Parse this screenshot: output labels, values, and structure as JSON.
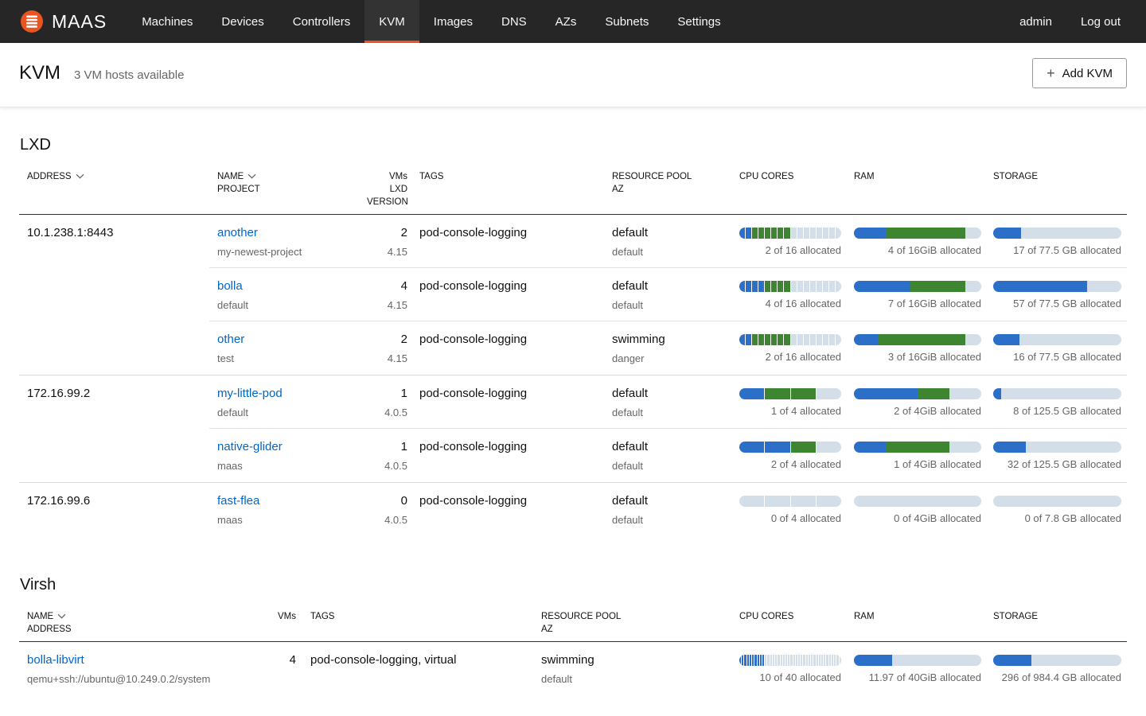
{
  "colors": {
    "nav_bg": "#262626",
    "nav_active_bg": "#333333",
    "accent_orange": "#E95420",
    "link_blue": "#0066CC",
    "meter_used": "#2C6FC8",
    "meter_other": "#3E8532",
    "meter_free": "#D3DEE8"
  },
  "nav": {
    "logo_text": "MAAS",
    "items": [
      {
        "label": "Machines",
        "active": false
      },
      {
        "label": "Devices",
        "active": false
      },
      {
        "label": "Controllers",
        "active": false
      },
      {
        "label": "KVM",
        "active": true
      },
      {
        "label": "Images",
        "active": false
      },
      {
        "label": "DNS",
        "active": false
      },
      {
        "label": "AZs",
        "active": false
      },
      {
        "label": "Subnets",
        "active": false
      },
      {
        "label": "Settings",
        "active": false
      }
    ],
    "right_items": [
      {
        "label": "admin"
      },
      {
        "label": "Log out"
      }
    ]
  },
  "header": {
    "title": "KVM",
    "subtitle": "3 VM hosts available",
    "add_button_label": "Add KVM",
    "add_button_icon": "+"
  },
  "lxd": {
    "title": "LXD",
    "headers": [
      {
        "line1": "ADDRESS",
        "sort": true
      },
      {
        "line1": "NAME",
        "line2": "PROJECT",
        "sort": true
      },
      {
        "line1": "VMs",
        "line2": "LXD VERSION",
        "align": "right"
      },
      {
        "line1": "TAGS"
      },
      {
        "line1": "RESOURCE POOL",
        "line2": "AZ"
      },
      {
        "line1": "CPU CORES"
      },
      {
        "line1": "RAM"
      },
      {
        "line1": "STORAGE"
      }
    ],
    "rows": [
      {
        "address": "10.1.238.1:8443",
        "group_start": true,
        "name": "another",
        "project": "my-newest-project",
        "vms": "2",
        "version": "4.15",
        "tags": "pod-console-logging",
        "pool": "default",
        "az": "default",
        "cpu": {
          "used": 2,
          "other": 6,
          "total": 16,
          "segments": 16,
          "label": "2 of 16 allocated"
        },
        "ram": {
          "used": 4,
          "other": 10,
          "total": 16,
          "label": "4 of 16GiB allocated"
        },
        "storage": {
          "used": 17,
          "other": 0,
          "total": 77.5,
          "label": "17 of 77.5 GB allocated"
        }
      },
      {
        "address": "",
        "group_start": false,
        "name": "bolla",
        "project": "default",
        "vms": "4",
        "version": "4.15",
        "tags": "pod-console-logging",
        "pool": "default",
        "az": "default",
        "cpu": {
          "used": 4,
          "other": 4,
          "total": 16,
          "segments": 16,
          "label": "4 of 16 allocated"
        },
        "ram": {
          "used": 7,
          "other": 7,
          "total": 16,
          "label": "7 of 16GiB allocated"
        },
        "storage": {
          "used": 57,
          "other": 0,
          "total": 77.5,
          "label": "57 of 77.5 GB allocated"
        }
      },
      {
        "address": "",
        "group_start": false,
        "name": "other",
        "project": "test",
        "vms": "2",
        "version": "4.15",
        "tags": "pod-console-logging",
        "pool": "swimming",
        "az": "danger",
        "cpu": {
          "used": 2,
          "other": 6,
          "total": 16,
          "segments": 16,
          "label": "2 of 16 allocated"
        },
        "ram": {
          "used": 3,
          "other": 11,
          "total": 16,
          "label": "3 of 16GiB allocated"
        },
        "storage": {
          "used": 16,
          "other": 0,
          "total": 77.5,
          "label": "16 of 77.5 GB allocated"
        }
      },
      {
        "address": "172.16.99.2",
        "group_start": true,
        "name": "my-little-pod",
        "project": "default",
        "vms": "1",
        "version": "4.0.5",
        "tags": "pod-console-logging",
        "pool": "default",
        "az": "default",
        "cpu": {
          "used": 1,
          "other": 2,
          "total": 4,
          "segments": 4,
          "label": "1 of 4 allocated"
        },
        "ram": {
          "used": 2,
          "other": 1,
          "total": 4,
          "label": "2 of 4GiB allocated"
        },
        "storage": {
          "used": 8,
          "other": 0,
          "total": 125.5,
          "label": "8 of 125.5 GB allocated"
        }
      },
      {
        "address": "",
        "group_start": false,
        "name": "native-glider",
        "project": "maas",
        "vms": "1",
        "version": "4.0.5",
        "tags": "pod-console-logging",
        "pool": "default",
        "az": "default",
        "cpu": {
          "used": 2,
          "other": 1,
          "total": 4,
          "segments": 4,
          "label": "2 of 4 allocated"
        },
        "ram": {
          "used": 1,
          "other": 2,
          "total": 4,
          "label": "1 of 4GiB allocated"
        },
        "storage": {
          "used": 32,
          "other": 0,
          "total": 125.5,
          "label": "32 of 125.5 GB allocated"
        }
      },
      {
        "address": "172.16.99.6",
        "group_start": true,
        "name": "fast-flea",
        "project": "maas",
        "vms": "0",
        "version": "4.0.5",
        "tags": "pod-console-logging",
        "pool": "default",
        "az": "default",
        "cpu": {
          "used": 0,
          "other": 0,
          "total": 4,
          "segments": 4,
          "label": "0 of 4 allocated"
        },
        "ram": {
          "used": 0,
          "other": 0,
          "total": 4,
          "label": "0 of 4GiB allocated"
        },
        "storage": {
          "used": 0,
          "other": 0,
          "total": 7.8,
          "label": "0 of 7.8 GB allocated"
        }
      }
    ]
  },
  "virsh": {
    "title": "Virsh",
    "headers": [
      {
        "line1": "NAME",
        "line2": "ADDRESS",
        "sort": true
      },
      {
        "line1": "VMs",
        "align": "right"
      },
      {
        "line1": "TAGS"
      },
      {
        "line1": "RESOURCE POOL",
        "line2": "AZ"
      },
      {
        "line1": "CPU CORES"
      },
      {
        "line1": "RAM"
      },
      {
        "line1": "STORAGE"
      }
    ],
    "rows": [
      {
        "name": "bolla-libvirt",
        "address": "qemu+ssh://ubuntu@10.249.0.2/system",
        "vms": "4",
        "tags": "pod-console-logging, virtual",
        "pool": "swimming",
        "az": "default",
        "cpu": {
          "used": 10,
          "other": 0,
          "total": 40,
          "segments": 40,
          "label": "10 of 40 allocated"
        },
        "ram": {
          "used": 11.97,
          "other": 0,
          "total": 40,
          "label": "11.97 of 40GiB allocated"
        },
        "storage": {
          "used": 296,
          "other": 0,
          "total": 984.4,
          "label": "296 of 984.4 GB allocated"
        }
      }
    ]
  }
}
